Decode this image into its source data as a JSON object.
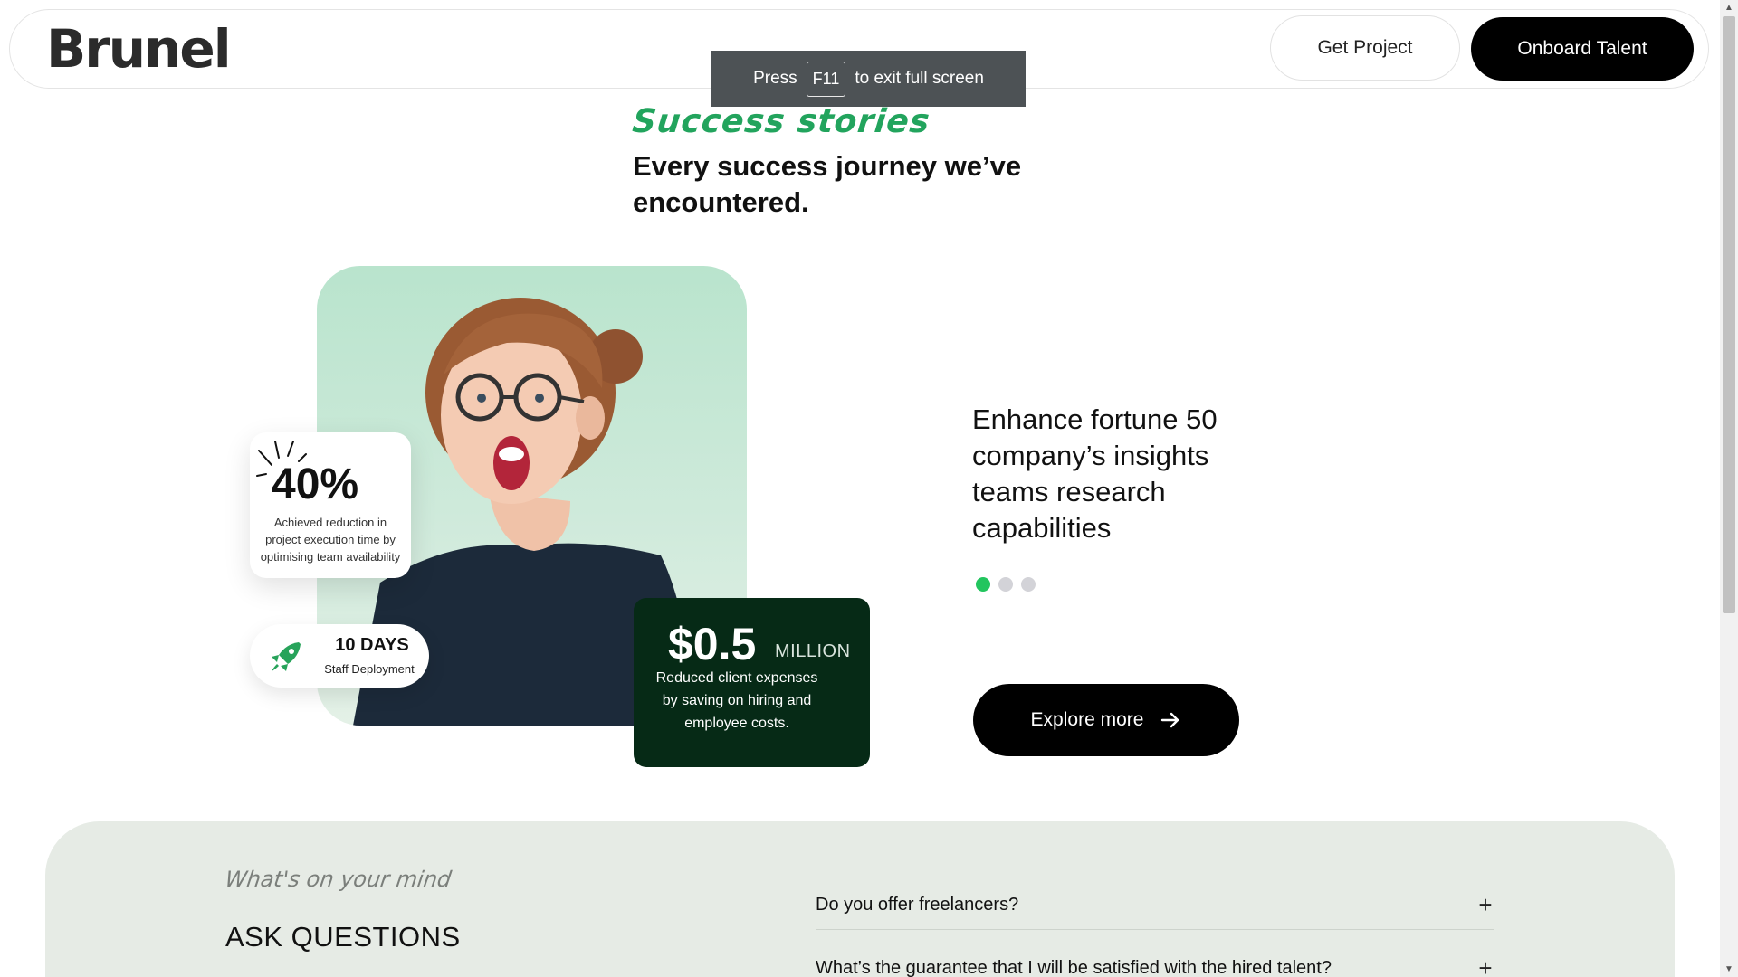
{
  "header": {
    "logo": "Brunel",
    "get_project": "Get Project",
    "onboard_talent": "Onboard Talent"
  },
  "fullscreen_notice": {
    "prefix": "Press",
    "key": "F11",
    "suffix": "to exit full screen"
  },
  "hero": {
    "eyebrow": "Success stories",
    "headline": "Every success journey we’ve encountered."
  },
  "stats": {
    "reduction": {
      "value": "40%",
      "description": "Achieved reduction in project execution time by optimising team availability"
    },
    "deployment": {
      "value": "10 DAYS",
      "label": "Staff Deployment"
    },
    "savings": {
      "value": "$0.5",
      "unit": "MILLION",
      "description": "Reduced client expenses by saving on hiring and employee costs."
    }
  },
  "story": {
    "title": "Enhance fortune 50 company’s insights teams research capabilities",
    "slides": 3,
    "active_slide": 1,
    "explore_label": "Explore more"
  },
  "faq": {
    "eyebrow": "What's on your mind",
    "title": "ASK QUESTIONS",
    "items": [
      {
        "question": "Do you offer freelancers?"
      },
      {
        "question": "What’s the guarantee that I will be satisfied with the hired talent?"
      }
    ]
  },
  "colors": {
    "accent_green": "#22a45d",
    "dot_active": "#22c55e",
    "dark_card": "#062a16",
    "faq_bg": "#e6ebe5"
  }
}
